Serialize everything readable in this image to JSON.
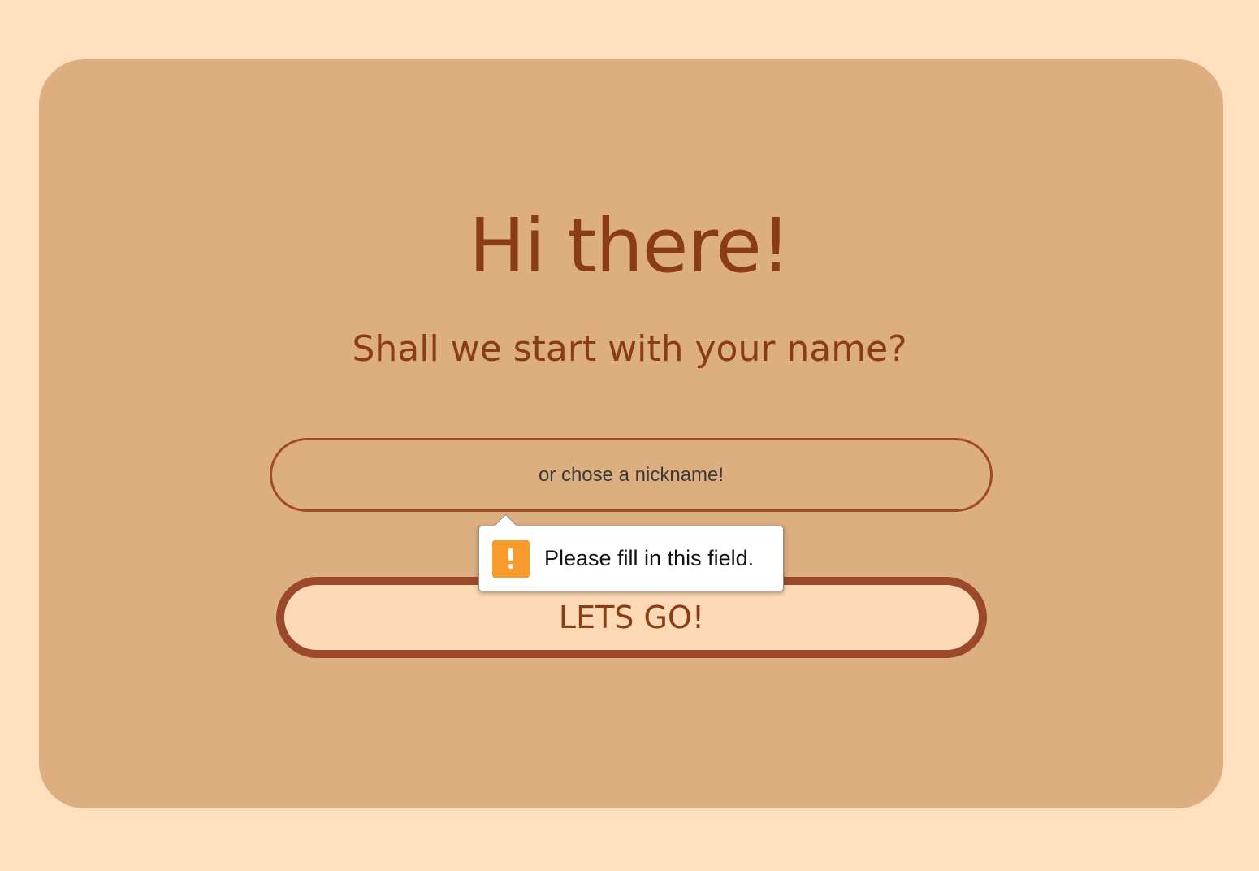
{
  "page": {
    "background_color": "#ffdfbe",
    "card_color": "#ddae80",
    "accent_color": "#8a3c17"
  },
  "welcome": {
    "title": "Hi there!",
    "subtitle": "Shall we start with your name?"
  },
  "name_form": {
    "input_value": "",
    "input_placeholder": "or chose a nickname!",
    "submit_label": "LETS GO!"
  },
  "validation_tooltip": {
    "icon": "warning-icon",
    "icon_color": "#f99a2c",
    "message": "Please fill in this field."
  }
}
